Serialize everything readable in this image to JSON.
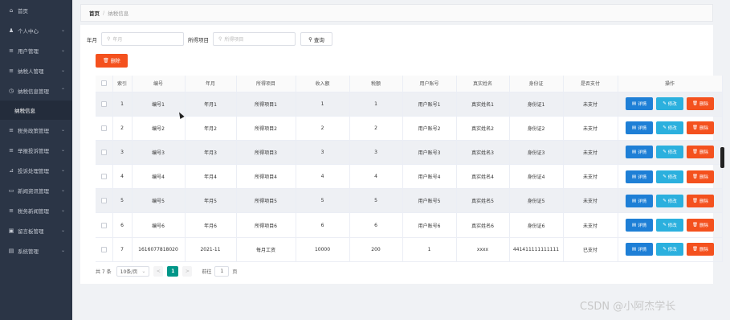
{
  "sidebar": {
    "items": [
      {
        "icon": "home-icon",
        "glyph": "⌂",
        "label": "首页",
        "arrow": ""
      },
      {
        "icon": "user-icon",
        "glyph": "♟",
        "label": "个人中心",
        "arrow": "⌄"
      },
      {
        "icon": "list-icon",
        "glyph": "≡",
        "label": "用户管理",
        "arrow": "⌄"
      },
      {
        "icon": "list-icon",
        "glyph": "≡",
        "label": "纳税人管理",
        "arrow": "⌄"
      },
      {
        "icon": "info-icon",
        "glyph": "◷",
        "label": "纳税信息管理",
        "arrow": "⌃"
      },
      {
        "icon": "list-icon",
        "glyph": "≡",
        "label": "税务政策管理",
        "arrow": "⌄"
      },
      {
        "icon": "list-icon",
        "glyph": "≡",
        "label": "举报投诉管理",
        "arrow": "⌄"
      },
      {
        "icon": "chart-icon",
        "glyph": "⊿",
        "label": "投诉处理管理",
        "arrow": "⌄"
      },
      {
        "icon": "chat-icon",
        "glyph": "▭",
        "label": "新闻资讯管理",
        "arrow": "⌄"
      },
      {
        "icon": "list-icon",
        "glyph": "≡",
        "label": "税务新闻管理",
        "arrow": "⌄"
      },
      {
        "icon": "board-icon",
        "glyph": "▣",
        "label": "留言板管理",
        "arrow": "⌄"
      },
      {
        "icon": "system-icon",
        "glyph": "▤",
        "label": "系统管理",
        "arrow": "⌄"
      }
    ],
    "active_sub": "纳税信息"
  },
  "breadcrumb": {
    "home": "首页",
    "sep": "/",
    "current": "纳税信息"
  },
  "search": {
    "label_month": "年月",
    "placeholder_month": "年月",
    "label_project": "所得项目",
    "placeholder_project": "所得项目",
    "query_label": "查询"
  },
  "delete_label": "删除",
  "table": {
    "headers": [
      "索引",
      "编号",
      "年月",
      "所得项目",
      "收入额",
      "税额",
      "用户账号",
      "真实姓名",
      "身份证",
      "是否支付",
      "操作"
    ],
    "rows": [
      [
        "1",
        "编号1",
        "年月1",
        "所得项目1",
        "1",
        "1",
        "用户账号1",
        "真实姓名1",
        "身份证1",
        "未支付"
      ],
      [
        "2",
        "编号2",
        "年月2",
        "所得项目2",
        "2",
        "2",
        "用户账号2",
        "真实姓名2",
        "身份证2",
        "未支付"
      ],
      [
        "3",
        "编号3",
        "年月3",
        "所得项目3",
        "3",
        "3",
        "用户账号3",
        "真实姓名3",
        "身份证3",
        "未支付"
      ],
      [
        "4",
        "编号4",
        "年月4",
        "所得项目4",
        "4",
        "4",
        "用户账号4",
        "真实姓名4",
        "身份证4",
        "未支付"
      ],
      [
        "5",
        "编号5",
        "年月5",
        "所得项目5",
        "5",
        "5",
        "用户账号5",
        "真实姓名5",
        "身份证5",
        "未支付"
      ],
      [
        "6",
        "编号6",
        "年月6",
        "所得项目6",
        "6",
        "6",
        "用户账号6",
        "真实姓名6",
        "身份证6",
        "未支付"
      ],
      [
        "7",
        "1616077818020",
        "2021-11",
        "每月工资",
        "10000",
        "200",
        "1",
        "xxxx",
        "441411111111111",
        "已支付"
      ]
    ],
    "actions": {
      "detail": "详情",
      "edit": "修改",
      "delete": "删除"
    }
  },
  "pager": {
    "total": "共 7 条",
    "page_size": "10条/页",
    "prev": "<",
    "current": "1",
    "next": ">",
    "goto_label": "前往",
    "goto_value": "1",
    "page_unit": "页"
  },
  "watermark": "CSDN @小阿杰学长",
  "colors": {
    "sidebar_bg": "#2b3546",
    "primary": "#1e7fd6",
    "info": "#2bb0de",
    "danger": "#f4511e",
    "page_active": "#009688"
  }
}
